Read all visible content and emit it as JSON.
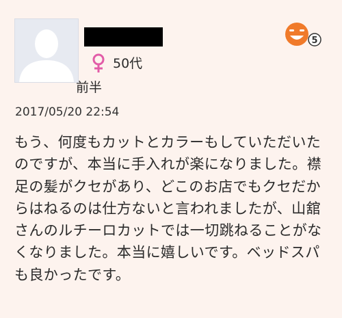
{
  "reviewer": {
    "age": "50代",
    "age_detail": "前半",
    "gender_icon": "female-symbol-icon",
    "avatar_icon": "default-user-silhouette-icon"
  },
  "rating": {
    "value": "5",
    "icon": "smiley-face-icon"
  },
  "review": {
    "date": "2017/05/20 22:54",
    "body": "もう、何度もカットとカラーもしていただいたのですが、本当に手入れが楽になりました。襟足の髪がクセがあり、どこのお店でもクセだからはねるのは仕方ないと言われましたが、山舘さんのルチーロカットでは一切跳ねることがなくなりました。本当に嬉しいです。ベッドスパも良かったです。"
  },
  "colors": {
    "background": "#fdf3ee",
    "gender_icon": "#e25ca8",
    "smiley_face": "#f07a2a",
    "redaction": "#000000"
  }
}
